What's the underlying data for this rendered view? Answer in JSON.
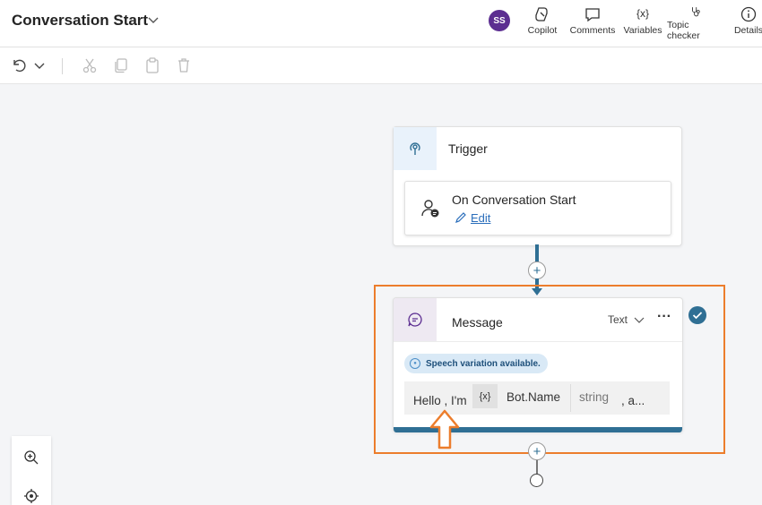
{
  "header": {
    "title": "Conversation Start",
    "avatar_initials": "SS",
    "buttons": [
      {
        "label": "Copilot",
        "icon": "copilot-icon"
      },
      {
        "label": "Comments",
        "icon": "comment-icon"
      },
      {
        "label": "Variables",
        "icon": "variables-icon",
        "glyph": "{x}"
      },
      {
        "label": "Topic checker",
        "icon": "stethoscope-icon"
      },
      {
        "label": "Details",
        "icon": "info-icon"
      }
    ]
  },
  "toolbar": {
    "icons": [
      "undo-icon",
      "chevron-down-icon",
      "cut-icon",
      "copy-icon",
      "paste-icon",
      "delete-icon"
    ]
  },
  "trigger_node": {
    "label": "Trigger",
    "inner_title": "On Conversation Start",
    "edit_label": "Edit"
  },
  "message_node": {
    "label": "Message",
    "type_label": "Text",
    "more_label": "···",
    "speech_badge": "Speech variation available.",
    "message_parts": {
      "prefix": "Hello , I'm",
      "var_glyph": "{x}",
      "var_name": "Bot.Name",
      "var_type": "string",
      "suffix": ", a..."
    }
  },
  "plus_label": "+",
  "colors": {
    "accent": "#2f6f94",
    "highlight": "#ec7d2c",
    "avatar": "#5c2e91",
    "check": "#2f6f94"
  }
}
